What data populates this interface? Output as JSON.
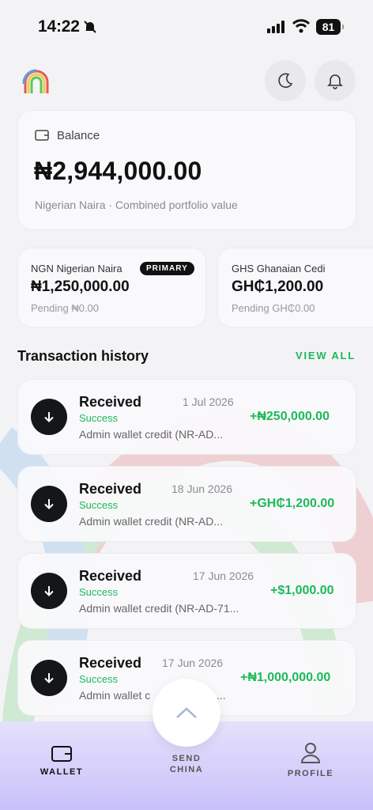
{
  "status_bar": {
    "time": "14:22",
    "battery": "81"
  },
  "header": {
    "logo_icon": "rainbow-logo",
    "theme_icon": "moon-icon",
    "notification_icon": "bell-icon"
  },
  "balance": {
    "label": "Balance",
    "amount": "₦2,944,000.00",
    "subtitle": "Nigerian Naira · Combined portfolio value"
  },
  "currencies": [
    {
      "name": "NGN Nigerian Naira",
      "badge": "PRIMARY",
      "amount": "₦1,250,000.00",
      "pending": "Pending ₦0.00"
    },
    {
      "name": "GHS Ghanaian Cedi",
      "amount": "GH₵1,200.00",
      "pending": "Pending GH₵0.00"
    }
  ],
  "history": {
    "title": "Transaction history",
    "view_all": "VIEW ALL",
    "items": [
      {
        "title": "Received",
        "date": "1 Jul 2026",
        "status": "Success",
        "desc": "Admin wallet credit (NR-AD...",
        "amount": "+₦250,000.00"
      },
      {
        "title": "Received",
        "date": "18 Jun 2026",
        "status": "Success",
        "desc": "Admin wallet credit (NR-AD...",
        "amount": "+GH₵1,200.00"
      },
      {
        "title": "Received",
        "date": "17 Jun 2026",
        "status": "Success",
        "desc": "Admin wallet credit (NR-AD-71...",
        "amount": "+$1,000.00"
      },
      {
        "title": "Received",
        "date": "17 Jun 2026",
        "status": "Success",
        "desc": "Admin wallet c",
        "desc_tail": "...",
        "amount": "+₦1,000,000.00"
      }
    ]
  },
  "nav": {
    "wallet": "WALLET",
    "send_line1": "SEND",
    "send_line2": "CHINA",
    "profile": "PROFILE"
  },
  "colors": {
    "accent_green": "#1db95a",
    "nav_gradient_top": "#e5e1fb",
    "nav_gradient_bottom": "#c9c1fb"
  }
}
